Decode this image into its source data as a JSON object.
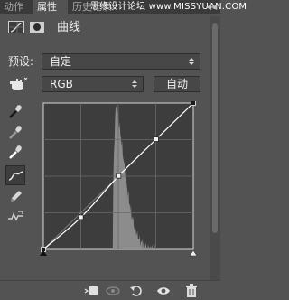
{
  "tabs": [
    {
      "label": "动作"
    },
    {
      "label": "属性"
    },
    {
      "label": "历史记录"
    }
  ],
  "watermark": "思缘设计论坛 www.MISSYUAN.COM",
  "header": {
    "title": "曲线"
  },
  "preset": {
    "label": "预设:",
    "value": "自定"
  },
  "channel": {
    "value": "RGB"
  },
  "auto_button": {
    "label": "自动"
  },
  "curve_points": [
    [
      0,
      0
    ],
    [
      64,
      56
    ],
    [
      128,
      128
    ],
    [
      192,
      192
    ],
    [
      255,
      255
    ]
  ],
  "histogram": {
    "shape": "single peak",
    "peak_level": 123,
    "range": [
      118,
      190
    ]
  },
  "colors": {
    "panel": "#535353",
    "graph_bg": "#3d3d3d",
    "histogram": "#8c8c8c",
    "curve": "#ffffff"
  },
  "icons": {
    "tools": [
      "target-adjust-icon",
      "sample-black-icon",
      "sample-gray-icon",
      "sample-white-icon",
      "curve-points-icon",
      "pencil-icon",
      "smooth-icon"
    ],
    "bottom": [
      "clip-to-layer-icon",
      "view-previous-icon",
      "reset-icon",
      "visibility-icon",
      "trash-icon"
    ]
  }
}
